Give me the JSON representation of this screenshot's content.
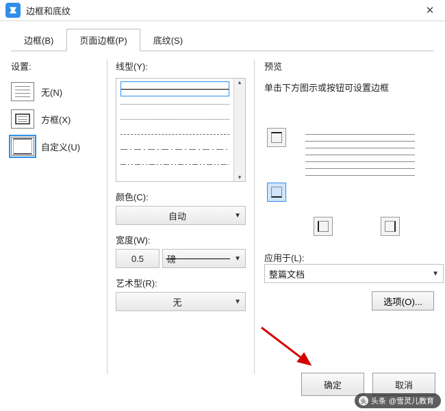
{
  "window": {
    "title": "边框和底纹"
  },
  "tabs": {
    "borders": "边框(B)",
    "page_border": "页面边框(P)",
    "shading": "底纹(S)"
  },
  "settings": {
    "label": "设置:",
    "none": "无(N)",
    "box": "方框(X)",
    "custom": "自定义(U)"
  },
  "line": {
    "label": "线型(Y):",
    "color_label": "颜色(C):",
    "color_value": "自动",
    "width_label": "宽度(W):",
    "width_value": "0.5",
    "width_unit": "磅",
    "art_label": "艺术型(R):",
    "art_value": "无"
  },
  "preview": {
    "label": "预览",
    "hint": "单击下方图示或按钮可设置边框",
    "apply_label": "应用于(L):",
    "apply_value": "整篇文档",
    "options": "选项(O)..."
  },
  "footer": {
    "ok": "确定",
    "cancel": "取消"
  },
  "watermark": {
    "prefix": "头条",
    "author": "@雪灵儿教育"
  }
}
